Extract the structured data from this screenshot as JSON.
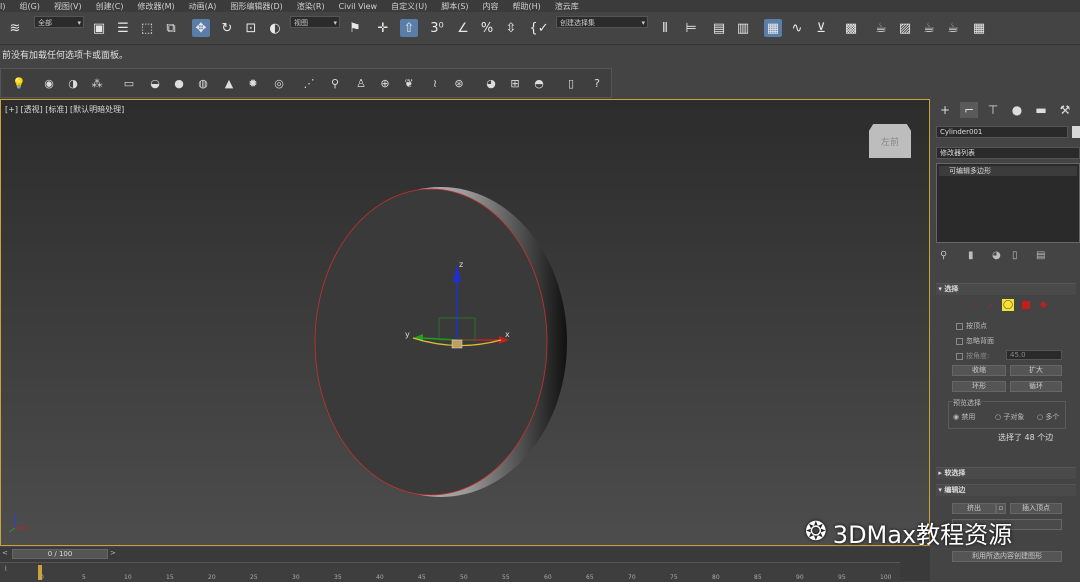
{
  "menu": [
    "I)",
    "组(G)",
    "视图(V)",
    "创建(C)",
    "修改器(M)",
    "动画(A)",
    "图形编辑器(D)",
    "渲染(R)",
    "Civil View",
    "自定义(U)",
    "脚本(S)",
    "内容",
    "帮助(H)",
    "渲云库"
  ],
  "toolbar": {
    "filter_select": "全部",
    "refcoord_select": "视图",
    "named_selection": "创建选择集"
  },
  "status": {
    "message": "前没有加载任何选项卡或面板。"
  },
  "viewport": {
    "label": "[+] [透视] [标准] [默认明暗处理]",
    "viewcube_label": "左前",
    "gizmo_x": "x",
    "gizmo_y": "y",
    "gizmo_z": "z"
  },
  "panel": {
    "object_name": "Cylinder001",
    "modifier_list": "修改器列表",
    "stack_item": "可编辑多边形",
    "selection_header": "选择",
    "by_vertex": "按顶点",
    "ignore_backfacing": "忽略背面",
    "by_angle": "按角度:",
    "angle_value": "45.0",
    "shrink": "收缩",
    "grow": "扩大",
    "ring": "环形",
    "loop": "循环",
    "preview_selection": "预览选择",
    "disable": "禁用",
    "subobject": "子对象",
    "multi": "多个",
    "selected_info": "选择了 48 个边",
    "soft_selection": "软选择",
    "edit_edges": "编辑边",
    "extrude": "挤出",
    "insert_vertex": "插入顶点",
    "create_shape": "利用所选内容创建图形"
  },
  "timeline": {
    "frame": "0 / 100",
    "ticks": [
      "0",
      "5",
      "10",
      "15",
      "20",
      "25",
      "30",
      "35",
      "40",
      "45",
      "50",
      "55",
      "60",
      "65",
      "70",
      "75",
      "80",
      "85",
      "90",
      "95",
      "100"
    ]
  },
  "watermark": "3DMax教程资源",
  "colors": {
    "accent": "#5a7ea8",
    "viewport_border": "#c9a23a",
    "subobj_active": "#e8e838",
    "subobj_red": "#c81c1c"
  }
}
